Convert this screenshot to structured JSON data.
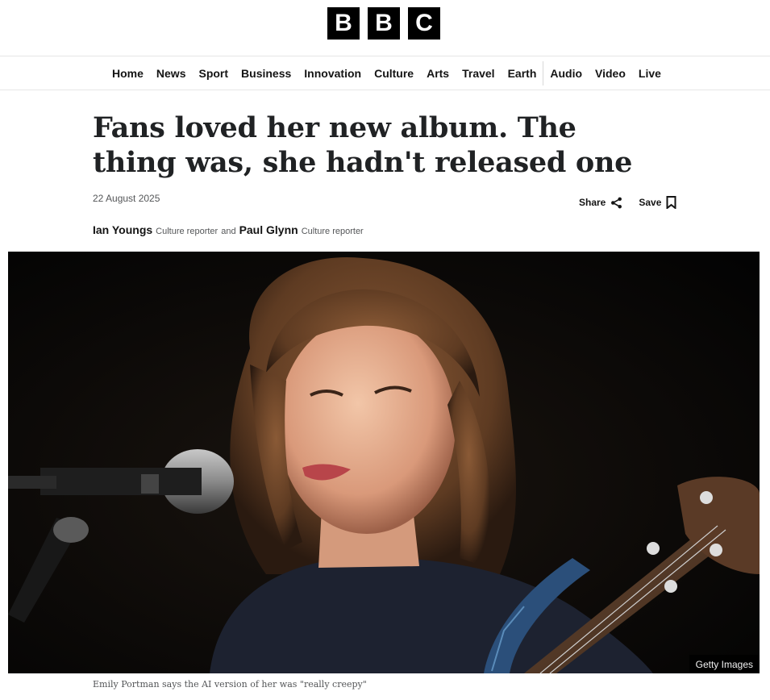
{
  "header": {
    "logo": [
      "B",
      "B",
      "C"
    ]
  },
  "nav": {
    "items": [
      "Home",
      "News",
      "Sport",
      "Business",
      "Innovation",
      "Culture",
      "Arts",
      "Travel",
      "Earth",
      "Audio",
      "Video",
      "Live"
    ]
  },
  "article": {
    "headline": "Fans loved her new album. The thing was, she hadn't released one",
    "date": "22 August 2025",
    "share_label": "Share",
    "save_label": "Save",
    "icons": {
      "share": "share-icon",
      "save": "bookmark-icon"
    },
    "authors": [
      {
        "name": "Ian Youngs",
        "role": "Culture reporter"
      },
      {
        "name": "Paul Glynn",
        "role": "Culture reporter"
      }
    ],
    "byline_joiner": "and",
    "image": {
      "credit": "Getty Images",
      "caption": "Emily Portman says the AI version of her was \"really creepy\""
    }
  },
  "colors": {
    "text": "#141414",
    "muted": "#545658",
    "logo_bg": "#000000",
    "border": "#e6e6e6"
  }
}
